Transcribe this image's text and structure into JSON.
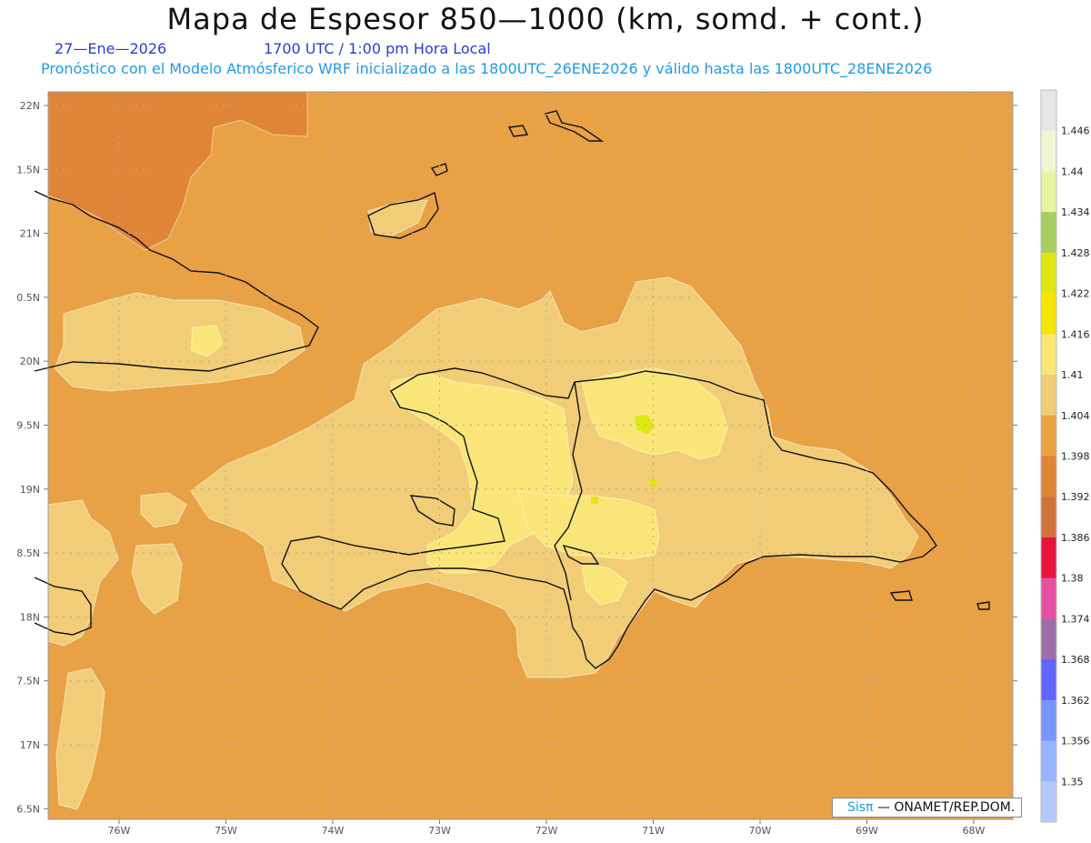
{
  "title": "Mapa de Espesor 850—1000 (km, somd. + cont.)",
  "date": "27—Ene—2026",
  "time": "1700 UTC / 1:00 pm Hora Local",
  "info": "Pronóstico con el Modelo Atmósferico WRF inicializado a las 1800UTC_26ENE2026 y válido hasta las  1800UTC_28ENE2026",
  "credit": {
    "sis": "Sisπ",
    "org": "— ONAMET/REP.DOM."
  },
  "lat_labels": [
    "22N",
    "1.5N",
    "21N",
    "0.5N",
    "20N",
    "9.5N",
    "19N",
    "8.5N",
    "18N",
    "7.5N",
    "17N",
    "6.5N"
  ],
  "lon_labels": [
    "76W",
    "75W",
    "74W",
    "73W",
    "72W",
    "71W",
    "70W",
    "69W",
    "68W"
  ],
  "colorbar": {
    "labels": [
      "1.446",
      "1.44",
      "1.434",
      "1.428",
      "1.422",
      "1.416",
      "1.41",
      "1.404",
      "1.398",
      "1.392",
      "1.386",
      "1.38",
      "1.374",
      "1.368",
      "1.362",
      "1.356",
      "1.35"
    ],
    "colors": [
      "#e6e6e6",
      "#f0f5d2",
      "#e6f5a0",
      "#a8cd60",
      "#e0e614",
      "#f5e600",
      "#fae678",
      "#f2cd78",
      "#e9a146",
      "#e08437",
      "#d2733c",
      "#e6143c",
      "#e650a0",
      "#9b6eaa",
      "#6464ff",
      "#7896ff",
      "#96b4ff",
      "#b4c8ff"
    ]
  },
  "fields": {
    "sea": "#e9a146",
    "northwest": "#e08437",
    "land_low": "#f2cd78",
    "land_high": "#fae678",
    "peak": "#e0e614"
  }
}
